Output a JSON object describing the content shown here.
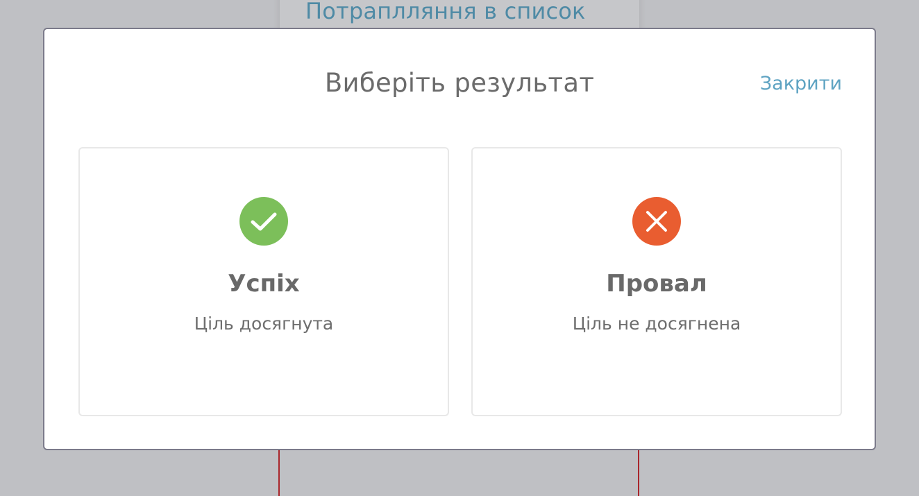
{
  "background": {
    "card_title": "Потраплляння в список"
  },
  "modal": {
    "title": "Виберіть результат",
    "close_label": "Закрити"
  },
  "options": [
    {
      "title": "Успіх",
      "subtitle": "Ціль досягнута",
      "icon": "check-icon",
      "color": "#7cbf5a"
    },
    {
      "title": "Провал",
      "subtitle": "Ціль не досягнена",
      "icon": "close-icon",
      "color": "#e95d30"
    }
  ],
  "colors": {
    "overlay": "#bfc0c4",
    "accent_link": "#5ea3c2",
    "success": "#7cbf5a",
    "failure": "#e95d30"
  }
}
